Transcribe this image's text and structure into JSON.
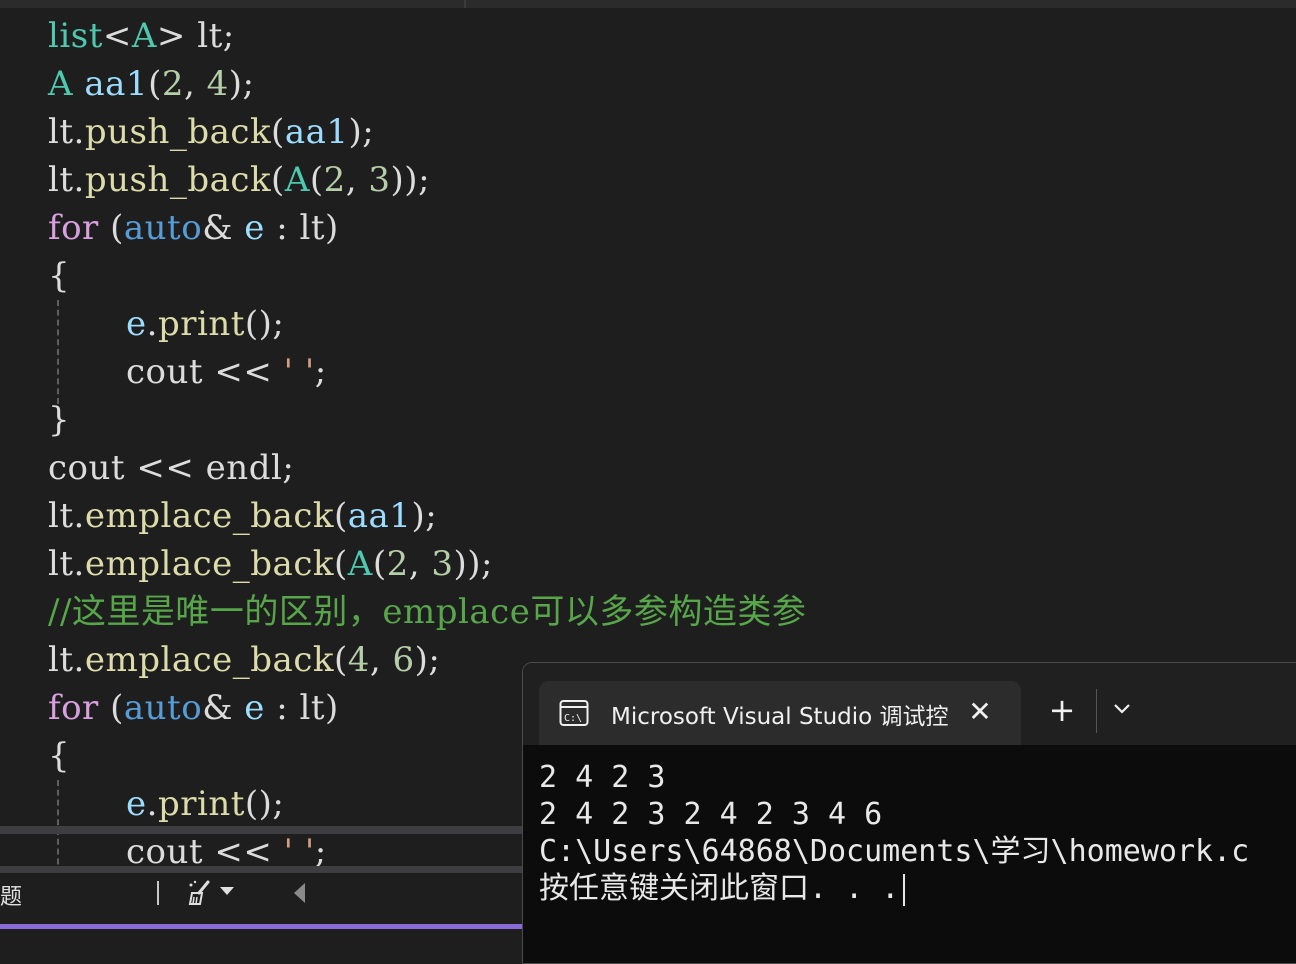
{
  "editor": {
    "lines": {
      "l1": [
        "list",
        "<",
        "A",
        ">",
        " lt;"
      ],
      "l2": [
        "A",
        " ",
        "aa1",
        "(",
        "2",
        ", ",
        "4",
        ");"
      ],
      "l3": [
        "lt.",
        "push_back",
        "(",
        "aa1",
        ");"
      ],
      "l4": [
        "lt.",
        "push_back",
        "(",
        "A",
        "(",
        "2",
        ", ",
        "3",
        "));"
      ],
      "l5": [
        "for",
        " (",
        "auto",
        "& ",
        "e",
        " : ",
        "lt",
        ")"
      ],
      "l6": [
        "{"
      ],
      "l7": [
        "e",
        ".",
        "print",
        "();"
      ],
      "l8": [
        "cout",
        " << ",
        "' '",
        ";"
      ],
      "l9": [
        "}"
      ],
      "l10": [
        "cout",
        " << ",
        "endl",
        ";"
      ],
      "l11": [
        "lt.",
        "emplace_back",
        "(",
        "aa1",
        ");"
      ],
      "l12": [
        "lt.",
        "emplace_back",
        "(",
        "A",
        "(",
        "2",
        ", ",
        "3",
        "));"
      ],
      "l13": [
        "//这里是唯一的区别，emplace可以多参构造类参"
      ],
      "l14": [
        "lt.",
        "emplace_back",
        "(",
        "4",
        ", ",
        "6",
        ");"
      ],
      "l15": [
        "for",
        " (",
        "auto",
        "& ",
        "e",
        " : ",
        "lt",
        ")"
      ],
      "l16": [
        "{"
      ],
      "l17": [
        "e",
        ".",
        "print",
        "();"
      ],
      "l18": [
        "cout",
        " << ",
        "' '",
        ";"
      ]
    }
  },
  "status_bar": {
    "label": "题",
    "icon": "clean-brush-icon"
  },
  "terminal": {
    "tab_title": "Microsoft Visual Studio 调试控",
    "close_symbol": "✕",
    "new_tab_symbol": "+",
    "output": [
      "2 4 2 3",
      "2 4 2 3 2 4 2 3 4 6",
      "C:\\Users\\64868\\Documents\\学习\\homework.c",
      "按任意键关闭此窗口. . ."
    ]
  },
  "colors": {
    "background": "#1e1e1e",
    "type": "#4ec9b0",
    "keyword": "#d8a0df",
    "auto": "#569cd6",
    "variable": "#9cdcfe",
    "function": "#dcdcaa",
    "number": "#b5cea8",
    "string": "#d69d85",
    "comment": "#57a64a",
    "accent": "#8a6ad6"
  }
}
